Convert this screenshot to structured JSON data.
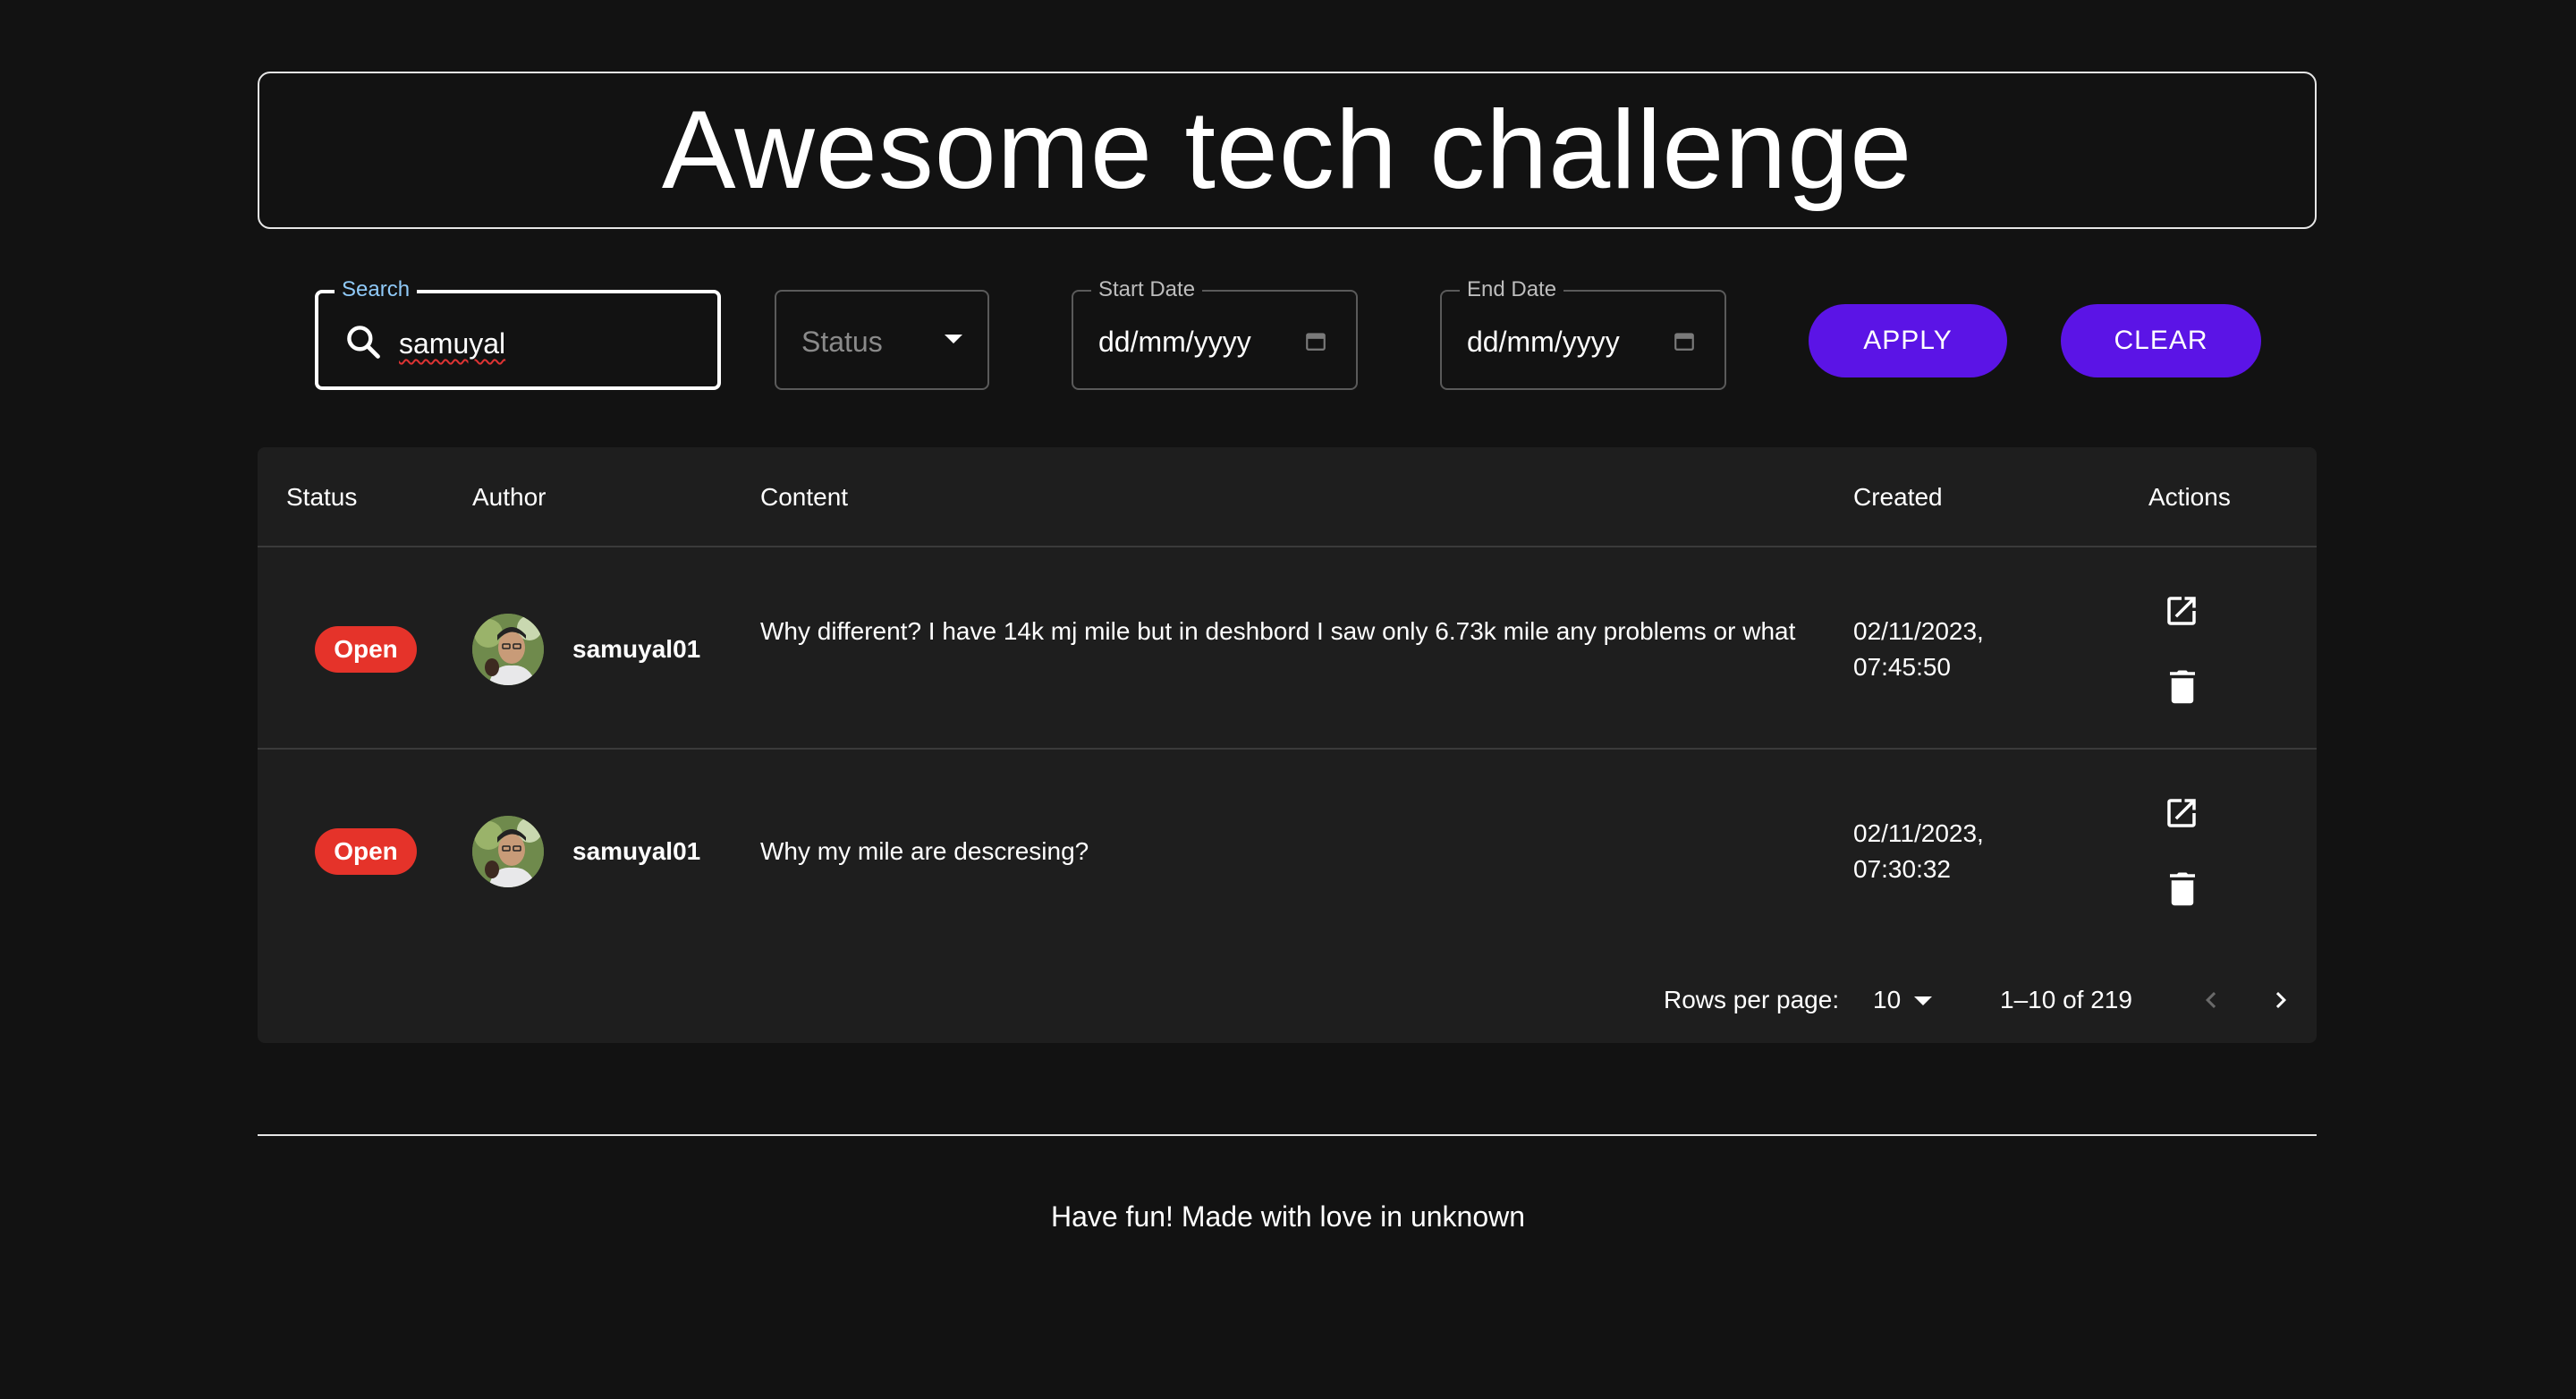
{
  "header": {
    "title": "Awesome tech challenge"
  },
  "filters": {
    "search_label": "Search",
    "search_value": "samuyal",
    "status_placeholder": "Status",
    "start_date_label": "Start Date",
    "start_date_value": "dd/mm/yyyy",
    "end_date_label": "End Date",
    "end_date_value": "dd/mm/yyyy",
    "apply_label": "APPLY",
    "clear_label": "CLEAR"
  },
  "table": {
    "columns": [
      "Status",
      "Author",
      "Content",
      "Created",
      "Actions"
    ],
    "rows": [
      {
        "status": "Open",
        "author": "samuyal01",
        "content": "Why different? I have 14k mj mile but in deshbord I saw only 6.73k mile any problems or what",
        "created_date": "02/11/2023,",
        "created_time": "07:45:50"
      },
      {
        "status": "Open",
        "author": "samuyal01",
        "content": "Why my mile are descresing?",
        "created_date": "02/11/2023,",
        "created_time": "07:30:32"
      }
    ],
    "pagination": {
      "rows_per_page_label": "Rows per page:",
      "rows_per_page_value": "10",
      "range": "1–10 of 219"
    }
  },
  "footer": {
    "text": "Have fun! Made with love in unknown"
  },
  "colors": {
    "background": "#121212",
    "surface": "#1e1e1e",
    "accent": "#5b14e6",
    "status_open": "#e5332a",
    "search_label": "#90caf9"
  },
  "icons": {
    "search": "search-icon",
    "status_dropdown": "arrow-drop-down-icon",
    "calendar": "calendar-icon",
    "open": "open-in-new-icon",
    "delete": "trash-icon",
    "prev": "chevron-left-icon",
    "next": "chevron-right-icon"
  }
}
